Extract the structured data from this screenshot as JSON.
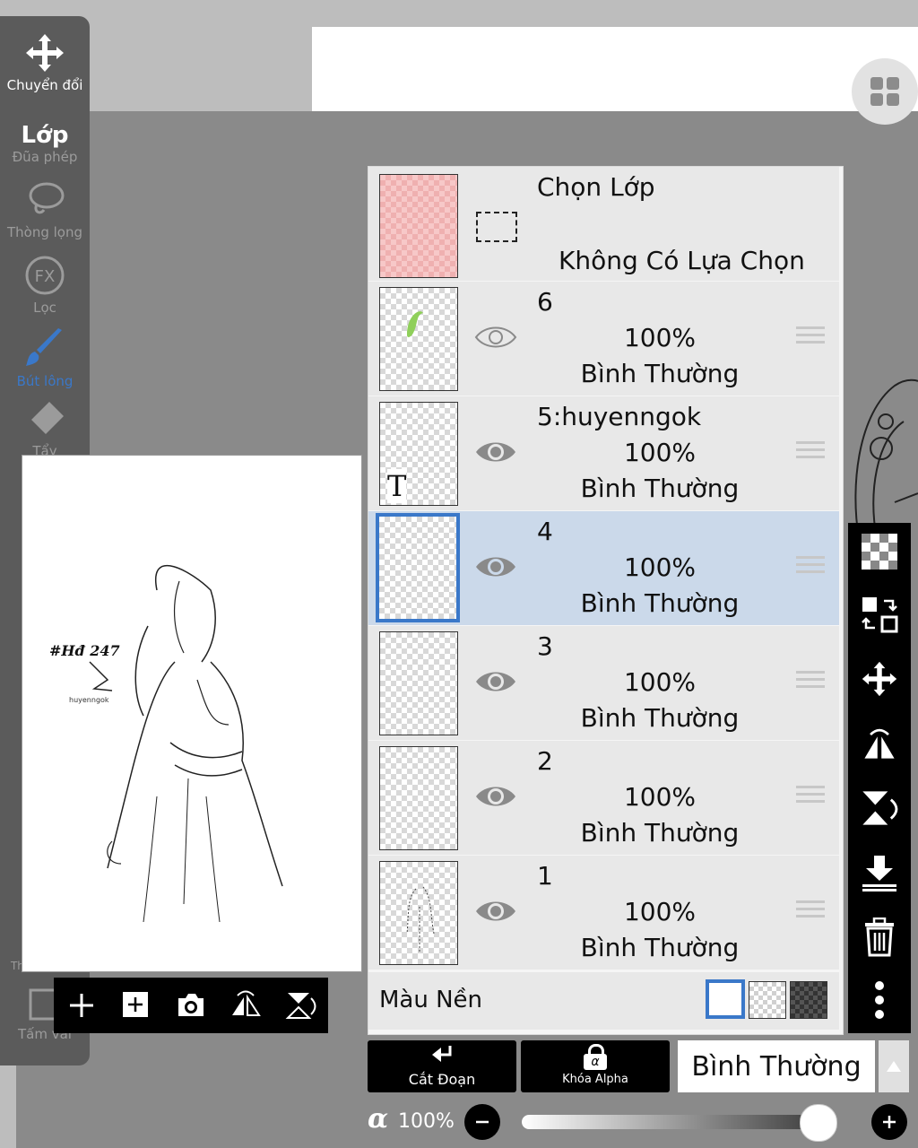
{
  "left_toolbar": {
    "tools": [
      {
        "label": "Chuyển đổi",
        "icon": "move-arrows-icon"
      },
      {
        "label": "Đũa phép",
        "icon": "magic-wand-icon"
      },
      {
        "label": "Thòng lọng",
        "icon": "lasso-icon"
      },
      {
        "label": "Lọc",
        "icon": "fx-filter-icon"
      },
      {
        "label": "Bút lông",
        "icon": "brush-icon"
      },
      {
        "label": "Tẩy",
        "icon": "eraser-icon"
      },
      {
        "label": "Thước hỗ trợ",
        "icon": "ruler-icon"
      },
      {
        "label": "Tấm vải",
        "icon": "canvas-icon"
      }
    ],
    "panel_title": "Lớp"
  },
  "preview": {
    "hashtag": "#Hđ 247",
    "signature": "huyenngok"
  },
  "layers": {
    "selection": {
      "title": "Chọn Lớp",
      "status": "Không Có Lựa Chọn"
    },
    "items": [
      {
        "name": "6",
        "opacity": "100%",
        "mode": "Bình Thường",
        "selected": false
      },
      {
        "name": "5:huyenngok",
        "opacity": "100%",
        "mode": "Bình Thường",
        "selected": false,
        "text_marker": "T"
      },
      {
        "name": "4",
        "opacity": "100%",
        "mode": "Bình Thường",
        "selected": true
      },
      {
        "name": "3",
        "opacity": "100%",
        "mode": "Bình Thường",
        "selected": false
      },
      {
        "name": "2",
        "opacity": "100%",
        "mode": "Bình Thường",
        "selected": false
      },
      {
        "name": "1",
        "opacity": "100%",
        "mode": "Bình Thường",
        "selected": false
      }
    ],
    "background_label": "Màu Nền"
  },
  "bottom": {
    "clip_label": "Cắt Đoạn",
    "alpha_lock_label": "Khóa Alpha",
    "alpha_symbol": "α",
    "blend_mode": "Bình Thường",
    "opacity_symbol": "α",
    "opacity_value": "100%",
    "opacity_fraction": 1.0
  },
  "colors": {
    "selected_row": "#cbd9ea",
    "accent_blue": "#3a78c9",
    "brush_tool": "#3a78c9"
  }
}
